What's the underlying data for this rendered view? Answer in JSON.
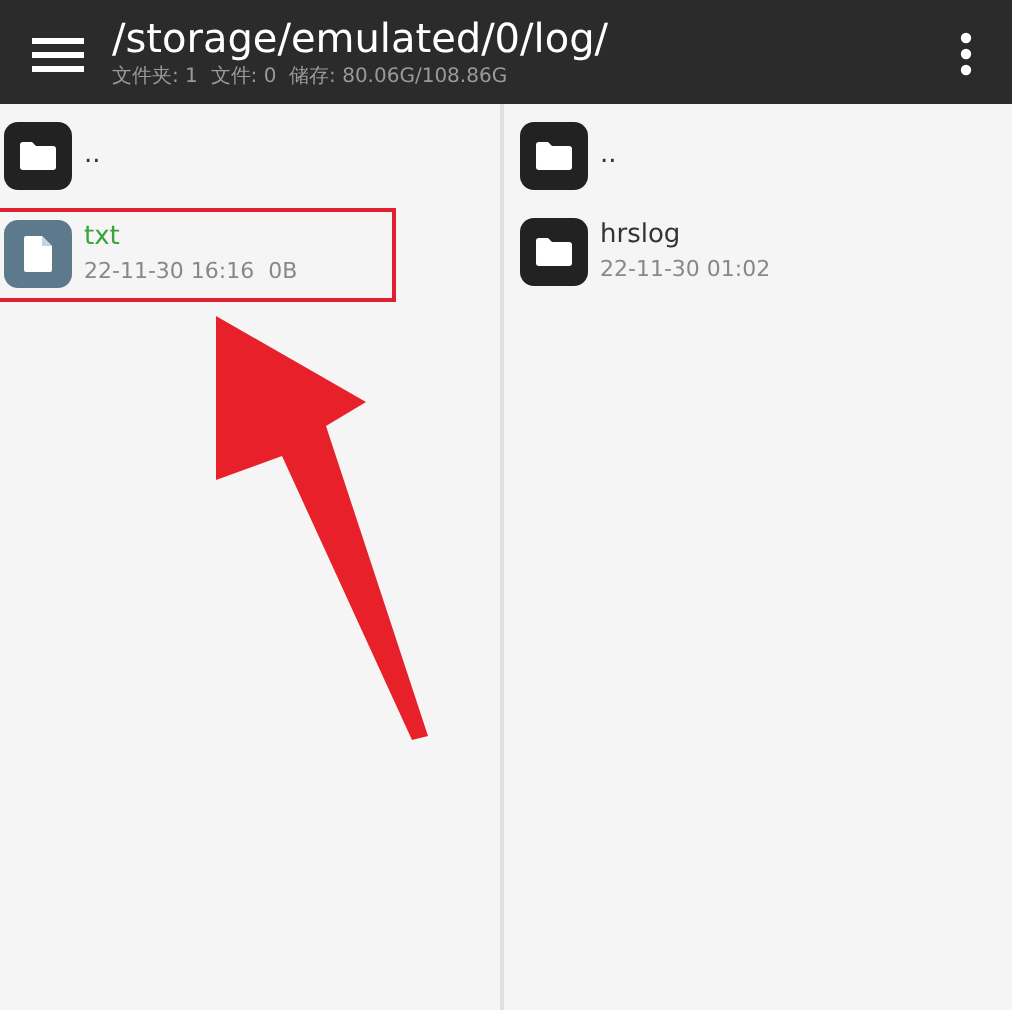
{
  "header": {
    "path": "/storage/emulated/0/log/",
    "summary": "文件夹: 1  文件: 0  储存: 80.06G/108.86G"
  },
  "panes": [
    {
      "items": [
        {
          "kind": "folder",
          "name": "..",
          "highlighted": false
        },
        {
          "kind": "file",
          "name": "txt",
          "meta": "22-11-30 16:16  0B",
          "highlighted": true
        }
      ]
    },
    {
      "items": [
        {
          "kind": "folder",
          "name": "..",
          "highlighted": false
        },
        {
          "kind": "folder",
          "name": "hrslog",
          "meta": "22-11-30 01:02",
          "highlighted": false
        }
      ]
    }
  ]
}
